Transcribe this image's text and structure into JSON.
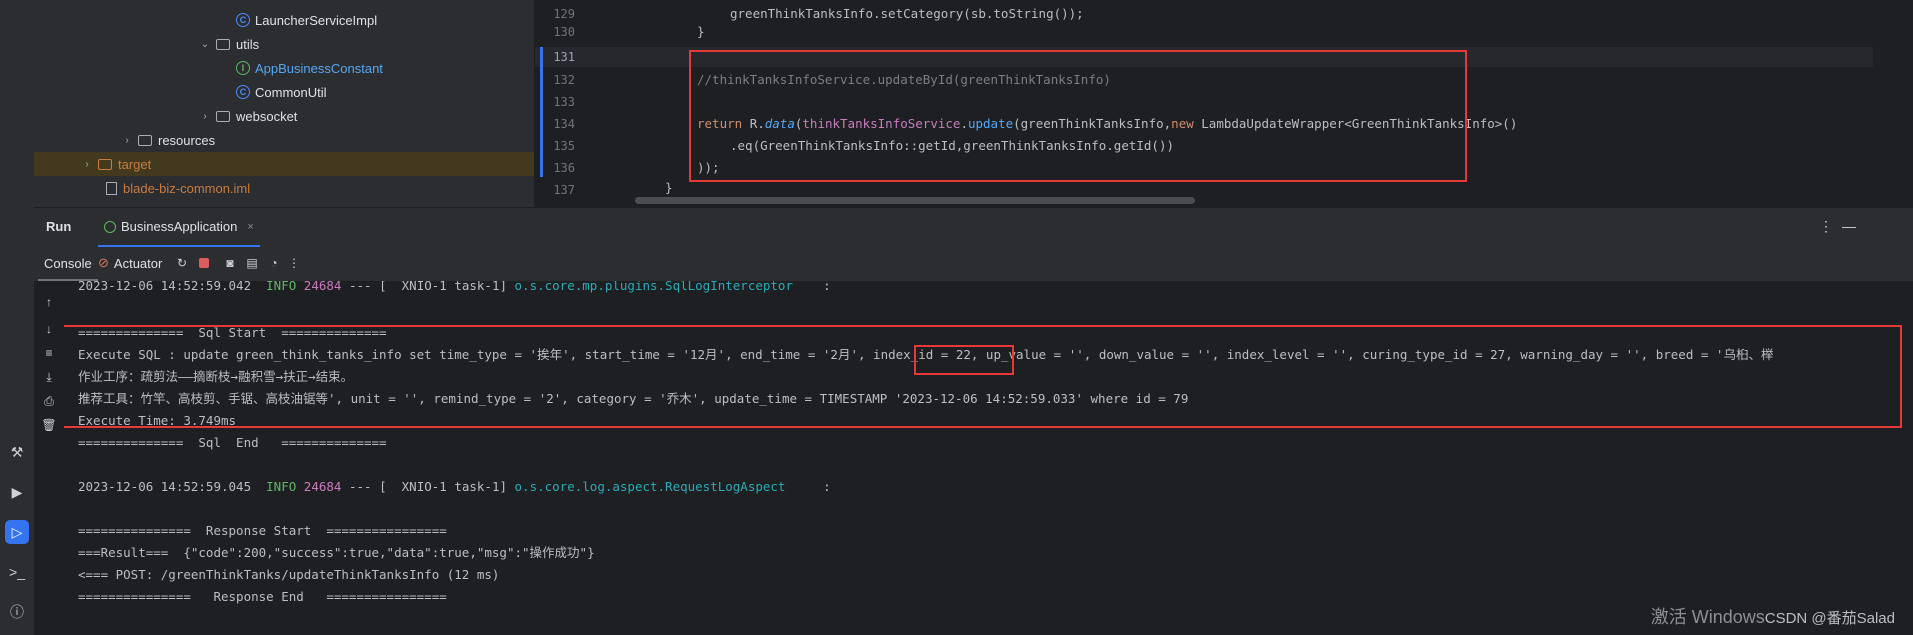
{
  "tree": {
    "items": [
      {
        "label": "LauncherServiceImpl",
        "kind": "class"
      },
      {
        "label": "utils",
        "kind": "folder"
      },
      {
        "label": "AppBusinessConstant",
        "kind": "interface"
      },
      {
        "label": "CommonUtil",
        "kind": "class"
      },
      {
        "label": "websocket",
        "kind": "folder"
      },
      {
        "label": "resources",
        "kind": "folder"
      },
      {
        "label": "target",
        "kind": "folder"
      },
      {
        "label": "blade-biz-common.iml",
        "kind": "file"
      }
    ]
  },
  "editor": {
    "line_numbers": [
      "129",
      "130",
      "131",
      "132",
      "133",
      "134",
      "135",
      "136",
      "137"
    ],
    "lines": {
      "l129": "greenThinkTanksInfo.setCategory(sb.toString());",
      "l130": "}",
      "l132": "//thinkTanksInfoService.updateById(greenThinkTanksInfo)",
      "l134_return": "return ",
      "l134_r": "R.",
      "l134_data": "data",
      "l134_open": "(",
      "l134_svc": "thinkTanksInfoService",
      "l134_dot": ".",
      "l134_update": "update",
      "l134_args": "(greenThinkTanksInfo,",
      "l134_new": "new ",
      "l134_rest": "LambdaUpdateWrapper<GreenThinkTanksInfo>()",
      "l135": ".eq(GreenThinkTanksInfo::getId,greenThinkTanksInfo.getId())",
      "l136": "));",
      "l137": "}"
    }
  },
  "run": {
    "title": "Run",
    "tab_label": "BusinessApplication",
    "close_glyph": "×",
    "console_tab": "Console",
    "actuator_tab": "Actuator"
  },
  "console": {
    "log1": {
      "ts": "2023-12-06 14:52:59.042",
      "level": "INFO",
      "pid": "24684",
      "sep": " --- [  XNIO-1 task-1] ",
      "logger": "o.s.core.mp.plugins.SqlLogInterceptor",
      "tail": "    :"
    },
    "sql_start": "==============  Sql Start  ==============",
    "sql_exec_a": "Execute SQL : update green_think_tanks_info set time_type = '挨年', start_time = '12月', end_time = '2月', ",
    "sql_index": "index_id = 22,",
    "sql_exec_b": " up_value = '', down_value = '', index_level = '', curing_type_id = 27, warning_day = '', breed = '乌桕、榉",
    "sql_work": "作业工序：疏剪法——摘断枝→融积雪→扶正→结束。",
    "sql_tools": "推荐工具：竹竿、高枝剪、手锯、高枝油锯等', unit = '', remind_type = '2', category = '乔木', update_time = TIMESTAMP '2023-12-06 14:52:59.033' where id = 79",
    "exec_time": "Execute Time: 3.749ms",
    "sql_end": "==============  Sql  End   ==============",
    "log2": {
      "ts": "2023-12-06 14:52:59.045",
      "level": "INFO",
      "pid": "24684",
      "sep": " --- [  XNIO-1 task-1] ",
      "logger": "o.s.core.log.aspect.RequestLogAspect",
      "tail": "     :"
    },
    "resp_start": "===============  Response Start  ================",
    "result": "===Result===  {\"code\":200,\"success\":true,\"data\":true,\"msg\":\"操作成功\"}",
    "post": "<=== POST: /greenThinkTanks/updateThinkTanksInfo (12 ms)",
    "resp_end": "===============   Response End   ================"
  },
  "watermark": {
    "windows": "激活 Windows",
    "csdn": "CSDN @番茄Salad"
  },
  "colors": {
    "highlight_box": "#e53935",
    "accent": "#3574f0",
    "info": "#5fb865",
    "logger": "#2aacb8"
  }
}
